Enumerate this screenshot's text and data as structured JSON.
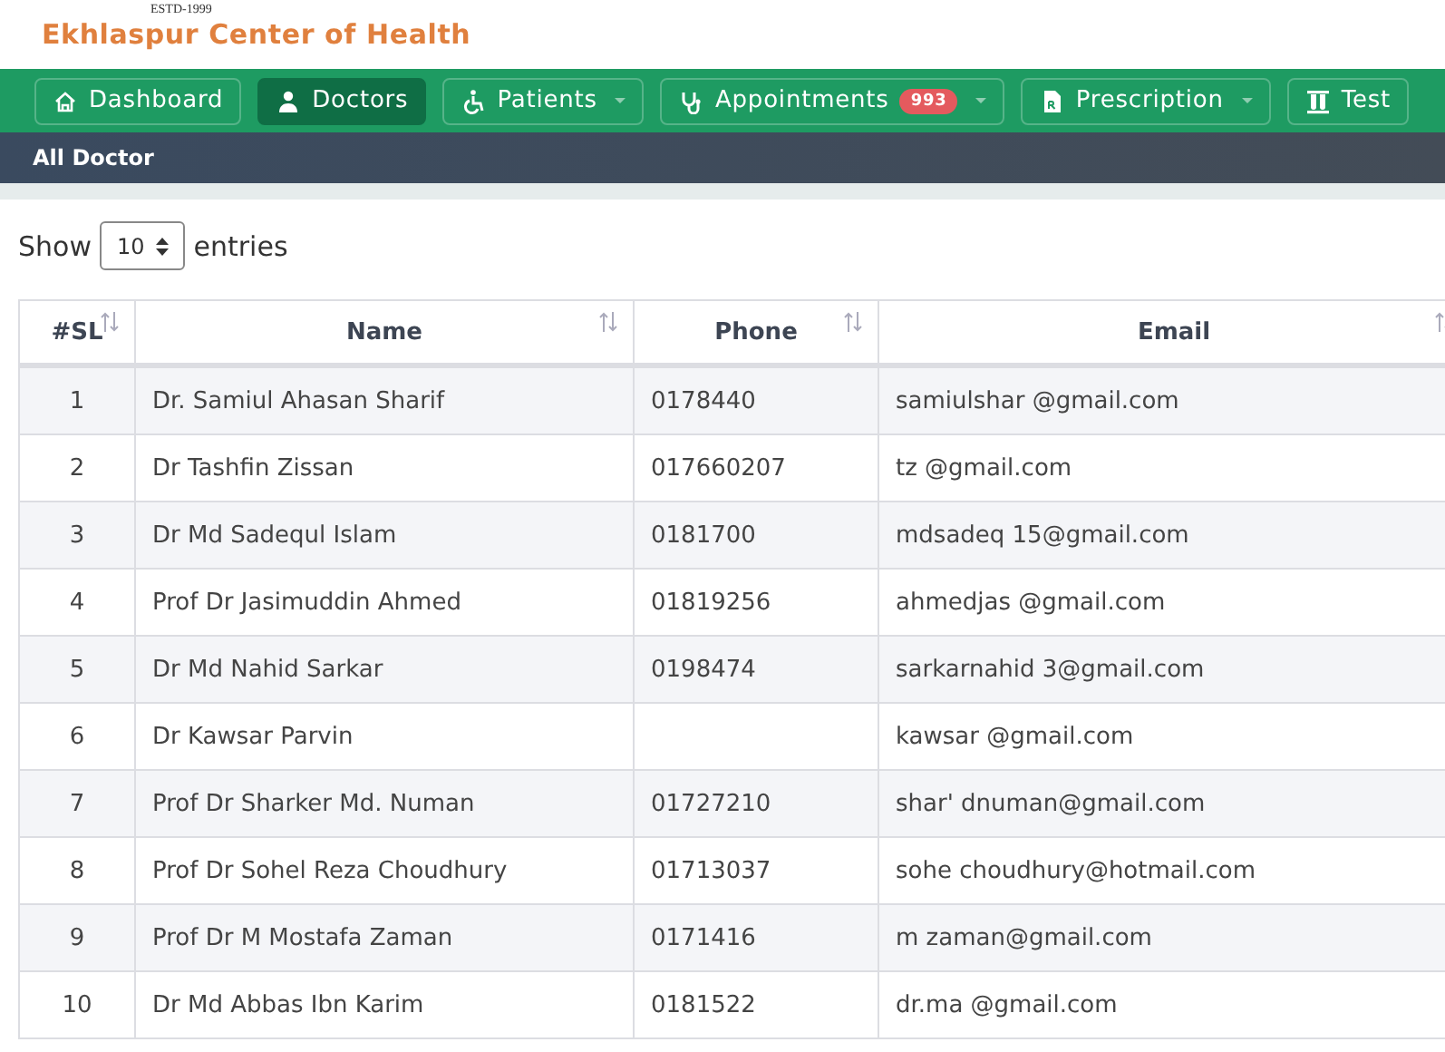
{
  "header": {
    "tagline": "ESTD-1999",
    "title": "Ekhlaspur Center of Health"
  },
  "nav": [
    {
      "label": "Dashboard",
      "selected": false,
      "dropdown": false
    },
    {
      "label": "Doctors",
      "selected": true,
      "dropdown": false
    },
    {
      "label": "Patients",
      "selected": false,
      "dropdown": true
    },
    {
      "label": "Appointments",
      "selected": false,
      "dropdown": true,
      "badge": "993"
    },
    {
      "label": "Prescription",
      "selected": false,
      "dropdown": true
    },
    {
      "label": "Test",
      "selected": false,
      "dropdown": false
    }
  ],
  "breadcrumb": "All Doctor",
  "length_menu": {
    "prefix": "Show",
    "value": "10",
    "suffix": "entries"
  },
  "table": {
    "columns": [
      {
        "label": "#SL"
      },
      {
        "label": "Name"
      },
      {
        "label": "Phone"
      },
      {
        "label": "Email"
      }
    ],
    "rows": [
      {
        "sl": "1",
        "name": "Dr. Samiul Ahasan Sharif",
        "phone": "0178440",
        "email": "samiulshar @gmail.com"
      },
      {
        "sl": "2",
        "name": "Dr Tashfin Zissan",
        "phone": "017660207",
        "email": "tz @gmail.com"
      },
      {
        "sl": "3",
        "name": "Dr Md Sadequl Islam",
        "phone": "0181700",
        "email": "mdsadeq 15@gmail.com"
      },
      {
        "sl": "4",
        "name": "Prof Dr Jasimuddin Ahmed",
        "phone": "01819256",
        "email": "ahmedjas @gmail.com"
      },
      {
        "sl": "5",
        "name": "Dr Md Nahid Sarkar",
        "phone": "0198474",
        "email": "sarkarnahid 3@gmail.com"
      },
      {
        "sl": "6",
        "name": "Dr Kawsar Parvin",
        "email": "kawsar @gmail.com"
      },
      {
        "sl": "7",
        "name": "Prof Dr Sharker Md. Numan",
        "phone": "01727210",
        "email": "shar' dnuman@gmail.com"
      },
      {
        "sl": "8",
        "name": "Prof Dr Sohel Reza Choudhury",
        "phone": "01713037",
        "email": "sohe choudhury@hotmail.com"
      },
      {
        "sl": "9",
        "name": "Prof Dr M Mostafa Zaman",
        "phone": "0171416",
        "email": "m zaman@gmail.com"
      },
      {
        "sl": "10",
        "name": "Dr Md Abbas Ibn Karim",
        "phone": "0181522",
        "email": "dr.ma @gmail.com"
      }
    ]
  }
}
